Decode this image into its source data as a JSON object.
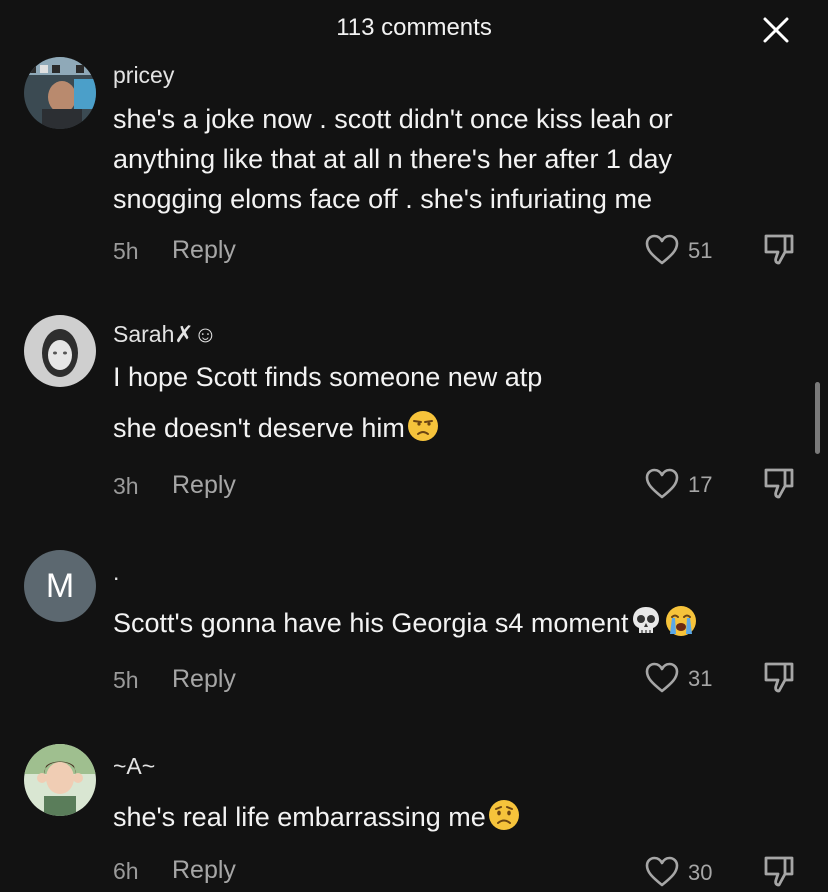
{
  "header": {
    "title": "113 comments"
  },
  "comments": [
    {
      "username": "pricey",
      "lines": [
        "she's a joke now . scott didn't once kiss leah or",
        "anything like that at all n there's her after 1 day",
        "snogging eloms face off . she's infuriating me"
      ],
      "time": "5h",
      "reply": "Reply",
      "likes": "51"
    },
    {
      "username": "Sarah✗☺",
      "lines": [
        "I hope Scott finds someone new atp",
        "she doesn't deserve him"
      ],
      "emoji": "unamused-face-icon",
      "time": "3h",
      "reply": "Reply",
      "likes": "17"
    },
    {
      "avatar_letter": "M",
      "username": ".",
      "lines": [
        "Scott's gonna have his Georgia s4 moment"
      ],
      "emoji": [
        "skull-icon",
        "loudly-crying-face-icon"
      ],
      "time": "5h",
      "reply": "Reply",
      "likes": "31"
    },
    {
      "username": "~A~",
      "lines": [
        "she's real life embarrassing me"
      ],
      "emoji": "worried-face-icon",
      "time": "6h",
      "reply": "Reply",
      "likes": "30"
    }
  ],
  "colors": {
    "background": "#121212",
    "text": "#f3f3f3",
    "muted": "#a6a6a6"
  }
}
